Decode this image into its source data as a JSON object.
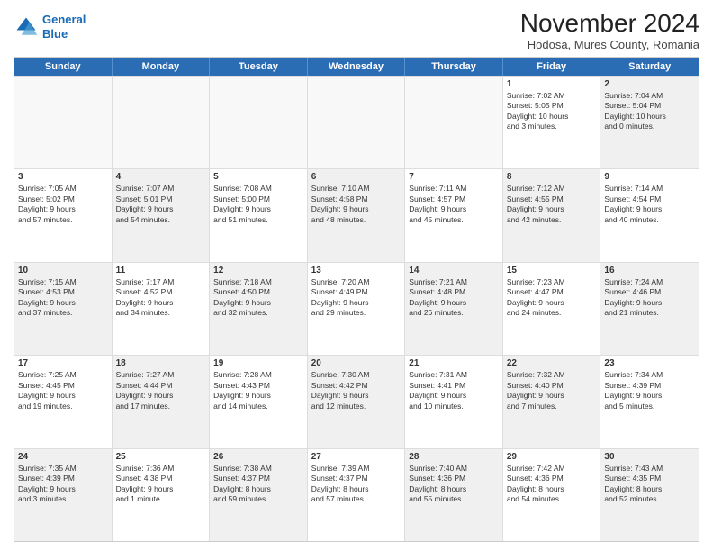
{
  "header": {
    "logo_line1": "General",
    "logo_line2": "Blue",
    "month": "November 2024",
    "location": "Hodosa, Mures County, Romania"
  },
  "weekdays": [
    "Sunday",
    "Monday",
    "Tuesday",
    "Wednesday",
    "Thursday",
    "Friday",
    "Saturday"
  ],
  "rows": [
    [
      {
        "day": "",
        "lines": [],
        "empty": true
      },
      {
        "day": "",
        "lines": [],
        "empty": true
      },
      {
        "day": "",
        "lines": [],
        "empty": true
      },
      {
        "day": "",
        "lines": [],
        "empty": true
      },
      {
        "day": "",
        "lines": [],
        "empty": true
      },
      {
        "day": "1",
        "lines": [
          "Sunrise: 7:02 AM",
          "Sunset: 5:05 PM",
          "Daylight: 10 hours",
          "and 3 minutes."
        ]
      },
      {
        "day": "2",
        "lines": [
          "Sunrise: 7:04 AM",
          "Sunset: 5:04 PM",
          "Daylight: 10 hours",
          "and 0 minutes."
        ],
        "shaded": true
      }
    ],
    [
      {
        "day": "3",
        "lines": [
          "Sunrise: 7:05 AM",
          "Sunset: 5:02 PM",
          "Daylight: 9 hours",
          "and 57 minutes."
        ]
      },
      {
        "day": "4",
        "lines": [
          "Sunrise: 7:07 AM",
          "Sunset: 5:01 PM",
          "Daylight: 9 hours",
          "and 54 minutes."
        ],
        "shaded": true
      },
      {
        "day": "5",
        "lines": [
          "Sunrise: 7:08 AM",
          "Sunset: 5:00 PM",
          "Daylight: 9 hours",
          "and 51 minutes."
        ]
      },
      {
        "day": "6",
        "lines": [
          "Sunrise: 7:10 AM",
          "Sunset: 4:58 PM",
          "Daylight: 9 hours",
          "and 48 minutes."
        ],
        "shaded": true
      },
      {
        "day": "7",
        "lines": [
          "Sunrise: 7:11 AM",
          "Sunset: 4:57 PM",
          "Daylight: 9 hours",
          "and 45 minutes."
        ]
      },
      {
        "day": "8",
        "lines": [
          "Sunrise: 7:12 AM",
          "Sunset: 4:55 PM",
          "Daylight: 9 hours",
          "and 42 minutes."
        ],
        "shaded": true
      },
      {
        "day": "9",
        "lines": [
          "Sunrise: 7:14 AM",
          "Sunset: 4:54 PM",
          "Daylight: 9 hours",
          "and 40 minutes."
        ]
      }
    ],
    [
      {
        "day": "10",
        "lines": [
          "Sunrise: 7:15 AM",
          "Sunset: 4:53 PM",
          "Daylight: 9 hours",
          "and 37 minutes."
        ],
        "shaded": true
      },
      {
        "day": "11",
        "lines": [
          "Sunrise: 7:17 AM",
          "Sunset: 4:52 PM",
          "Daylight: 9 hours",
          "and 34 minutes."
        ]
      },
      {
        "day": "12",
        "lines": [
          "Sunrise: 7:18 AM",
          "Sunset: 4:50 PM",
          "Daylight: 9 hours",
          "and 32 minutes."
        ],
        "shaded": true
      },
      {
        "day": "13",
        "lines": [
          "Sunrise: 7:20 AM",
          "Sunset: 4:49 PM",
          "Daylight: 9 hours",
          "and 29 minutes."
        ]
      },
      {
        "day": "14",
        "lines": [
          "Sunrise: 7:21 AM",
          "Sunset: 4:48 PM",
          "Daylight: 9 hours",
          "and 26 minutes."
        ],
        "shaded": true
      },
      {
        "day": "15",
        "lines": [
          "Sunrise: 7:23 AM",
          "Sunset: 4:47 PM",
          "Daylight: 9 hours",
          "and 24 minutes."
        ]
      },
      {
        "day": "16",
        "lines": [
          "Sunrise: 7:24 AM",
          "Sunset: 4:46 PM",
          "Daylight: 9 hours",
          "and 21 minutes."
        ],
        "shaded": true
      }
    ],
    [
      {
        "day": "17",
        "lines": [
          "Sunrise: 7:25 AM",
          "Sunset: 4:45 PM",
          "Daylight: 9 hours",
          "and 19 minutes."
        ]
      },
      {
        "day": "18",
        "lines": [
          "Sunrise: 7:27 AM",
          "Sunset: 4:44 PM",
          "Daylight: 9 hours",
          "and 17 minutes."
        ],
        "shaded": true
      },
      {
        "day": "19",
        "lines": [
          "Sunrise: 7:28 AM",
          "Sunset: 4:43 PM",
          "Daylight: 9 hours",
          "and 14 minutes."
        ]
      },
      {
        "day": "20",
        "lines": [
          "Sunrise: 7:30 AM",
          "Sunset: 4:42 PM",
          "Daylight: 9 hours",
          "and 12 minutes."
        ],
        "shaded": true
      },
      {
        "day": "21",
        "lines": [
          "Sunrise: 7:31 AM",
          "Sunset: 4:41 PM",
          "Daylight: 9 hours",
          "and 10 minutes."
        ]
      },
      {
        "day": "22",
        "lines": [
          "Sunrise: 7:32 AM",
          "Sunset: 4:40 PM",
          "Daylight: 9 hours",
          "and 7 minutes."
        ],
        "shaded": true
      },
      {
        "day": "23",
        "lines": [
          "Sunrise: 7:34 AM",
          "Sunset: 4:39 PM",
          "Daylight: 9 hours",
          "and 5 minutes."
        ]
      }
    ],
    [
      {
        "day": "24",
        "lines": [
          "Sunrise: 7:35 AM",
          "Sunset: 4:39 PM",
          "Daylight: 9 hours",
          "and 3 minutes."
        ],
        "shaded": true
      },
      {
        "day": "25",
        "lines": [
          "Sunrise: 7:36 AM",
          "Sunset: 4:38 PM",
          "Daylight: 9 hours",
          "and 1 minute."
        ]
      },
      {
        "day": "26",
        "lines": [
          "Sunrise: 7:38 AM",
          "Sunset: 4:37 PM",
          "Daylight: 8 hours",
          "and 59 minutes."
        ],
        "shaded": true
      },
      {
        "day": "27",
        "lines": [
          "Sunrise: 7:39 AM",
          "Sunset: 4:37 PM",
          "Daylight: 8 hours",
          "and 57 minutes."
        ]
      },
      {
        "day": "28",
        "lines": [
          "Sunrise: 7:40 AM",
          "Sunset: 4:36 PM",
          "Daylight: 8 hours",
          "and 55 minutes."
        ],
        "shaded": true
      },
      {
        "day": "29",
        "lines": [
          "Sunrise: 7:42 AM",
          "Sunset: 4:36 PM",
          "Daylight: 8 hours",
          "and 54 minutes."
        ]
      },
      {
        "day": "30",
        "lines": [
          "Sunrise: 7:43 AM",
          "Sunset: 4:35 PM",
          "Daylight: 8 hours",
          "and 52 minutes."
        ],
        "shaded": true
      }
    ]
  ]
}
